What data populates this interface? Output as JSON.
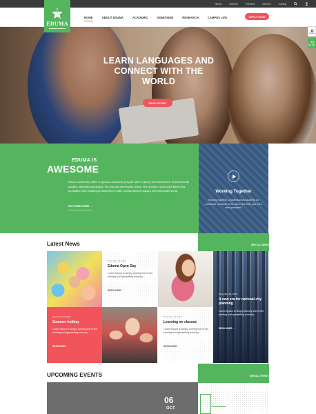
{
  "topbar": {
    "links": [
      "News",
      "Events",
      "Parents",
      "Alumni",
      "Giving"
    ],
    "icons": [
      "search-icon",
      "user-icon"
    ]
  },
  "header": {
    "logo_text": "EDUMA",
    "nav": [
      "HOME",
      "ABOUT EDUMA",
      "ACADEMIC",
      "ADMISSION",
      "RESEARCH",
      "CAMPUS LIFE"
    ],
    "active_nav": "HOME",
    "apply_label": "APPLY NOW"
  },
  "hero": {
    "title_line1": "LEARN LANGUAGES AND",
    "title_line2": "CONNECT WITH THE",
    "title_line3": "WORLD",
    "cta": "READ STORY"
  },
  "side_tabs": [
    "Options",
    "Buy Now"
  ],
  "awesome": {
    "eyebrow": "EDUMA IS",
    "title": "AWESOME",
    "description": "Eduma University offers a rigorous academic program with a history of excellence in environmental studies, international studies, the arts and community action. We provide a rock solid liberal arts foundation that challenges students to make contributions to today's interconnected world.",
    "link": "EXPLORE MORE →"
  },
  "working": {
    "title": "Working Together",
    "description": "Working together, a professor two students do workflows, research in the lab, in the field, and even more president."
  },
  "news": {
    "heading": "Latest News",
    "see_all": "SEE ALL NEWS",
    "items": [
      {
        "date": "November 10, 2016",
        "title": "Eduma Open Day",
        "text": "Lorem Ipsum is simply dummy text of the printing and typesetting industry...",
        "more": "READ MORE →"
      },
      {
        "date": "November 10, 2016",
        "title": "Summer holiday",
        "text": "Lorem Ipsum is simply dummy text of the printing and typesetting industry...",
        "more": "READ MORE →"
      },
      {
        "date": "November 10, 2016",
        "title": "Learning on classes",
        "text": "Lorem Ipsum is simply dummy text of the printing and typesetting industry...",
        "more": "READ MORE →"
      },
      {
        "date": "November 10, 2016",
        "title": "A new era for national city planning",
        "text": "Lorem Ipsum is simply dummy text of the printing and typesetting industry...",
        "more": "READ MORE →"
      }
    ]
  },
  "events": {
    "heading": "UPCOMING EVENTS",
    "see_all": "SEE ALL EVENTS",
    "day": "06",
    "month": "OCT"
  }
}
